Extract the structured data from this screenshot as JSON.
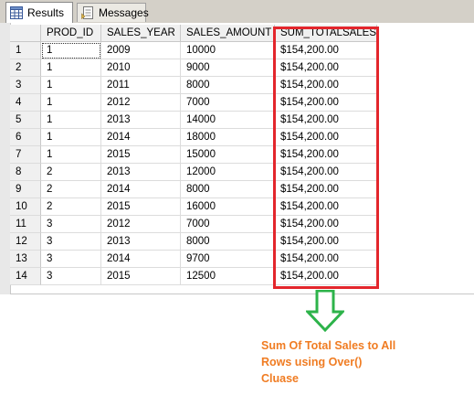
{
  "tabs": [
    {
      "label": "Results",
      "icon": "grid-icon"
    },
    {
      "label": "Messages",
      "icon": "messages-icon"
    }
  ],
  "columns": [
    "PROD_ID",
    "SALES_YEAR",
    "SALES_AMOUNT",
    "SUM_TOTALSALES"
  ],
  "rows": [
    {
      "num": "1",
      "prod_id": "1",
      "sales_year": "2009",
      "sales_amount": "10000",
      "sum_totalsales": "$154,200.00"
    },
    {
      "num": "2",
      "prod_id": "1",
      "sales_year": "2010",
      "sales_amount": "9000",
      "sum_totalsales": "$154,200.00"
    },
    {
      "num": "3",
      "prod_id": "1",
      "sales_year": "2011",
      "sales_amount": "8000",
      "sum_totalsales": "$154,200.00"
    },
    {
      "num": "4",
      "prod_id": "1",
      "sales_year": "2012",
      "sales_amount": "7000",
      "sum_totalsales": "$154,200.00"
    },
    {
      "num": "5",
      "prod_id": "1",
      "sales_year": "2013",
      "sales_amount": "14000",
      "sum_totalsales": "$154,200.00"
    },
    {
      "num": "6",
      "prod_id": "1",
      "sales_year": "2014",
      "sales_amount": "18000",
      "sum_totalsales": "$154,200.00"
    },
    {
      "num": "7",
      "prod_id": "1",
      "sales_year": "2015",
      "sales_amount": "15000",
      "sum_totalsales": "$154,200.00"
    },
    {
      "num": "8",
      "prod_id": "2",
      "sales_year": "2013",
      "sales_amount": "12000",
      "sum_totalsales": "$154,200.00"
    },
    {
      "num": "9",
      "prod_id": "2",
      "sales_year": "2014",
      "sales_amount": "8000",
      "sum_totalsales": "$154,200.00"
    },
    {
      "num": "10",
      "prod_id": "2",
      "sales_year": "2015",
      "sales_amount": "16000",
      "sum_totalsales": "$154,200.00"
    },
    {
      "num": "11",
      "prod_id": "3",
      "sales_year": "2012",
      "sales_amount": "7000",
      "sum_totalsales": "$154,200.00"
    },
    {
      "num": "12",
      "prod_id": "3",
      "sales_year": "2013",
      "sales_amount": "8000",
      "sum_totalsales": "$154,200.00"
    },
    {
      "num": "13",
      "prod_id": "3",
      "sales_year": "2014",
      "sales_amount": "9700",
      "sum_totalsales": "$154,200.00"
    },
    {
      "num": "14",
      "prod_id": "3",
      "sales_year": "2015",
      "sales_amount": "12500",
      "sum_totalsales": "$154,200.00"
    }
  ],
  "annotation": {
    "text": "Sum Of Total Sales to All\nRows using Over()\nCluase",
    "highlight_color": "#e3262c",
    "arrow_color": "#2db34a",
    "text_color": "#f07c22",
    "arrow_icon": "down-arrow-icon"
  }
}
